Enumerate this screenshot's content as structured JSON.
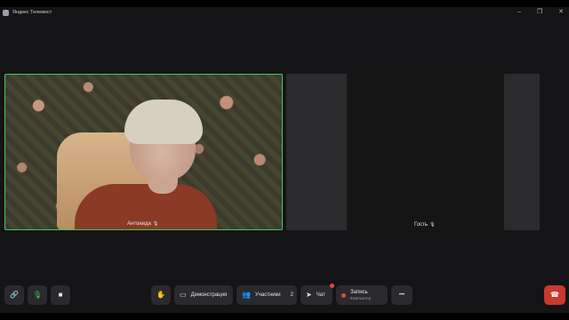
{
  "window": {
    "title": "Яндекс Телемост",
    "controls": [
      "–",
      "❐",
      "✕"
    ]
  },
  "participants": [
    {
      "name": "Антонида",
      "mic": "mic-icon",
      "active": true
    },
    {
      "name": "Гость",
      "mic": "mic-icon",
      "active": false
    }
  ],
  "toolbar": {
    "link_icon": "🔗",
    "mic_icon": "🎙",
    "camera_icon": "■",
    "raise_hand_icon": "✋",
    "demo_label": "Демонстрация",
    "demo_icon": "▭",
    "participants_label": "Участники",
    "participants_icon": "👥",
    "participants_count": "2",
    "chat_label": "Чат",
    "chat_icon": "➤",
    "record_label": "Запись",
    "record_sub": "Компьютер",
    "more_icon": "•••",
    "hangup_icon": "☎"
  },
  "colors": {
    "active_border": "#3ecb5c",
    "hangup": "#c73a2d",
    "record_dot": "#e0483c"
  }
}
